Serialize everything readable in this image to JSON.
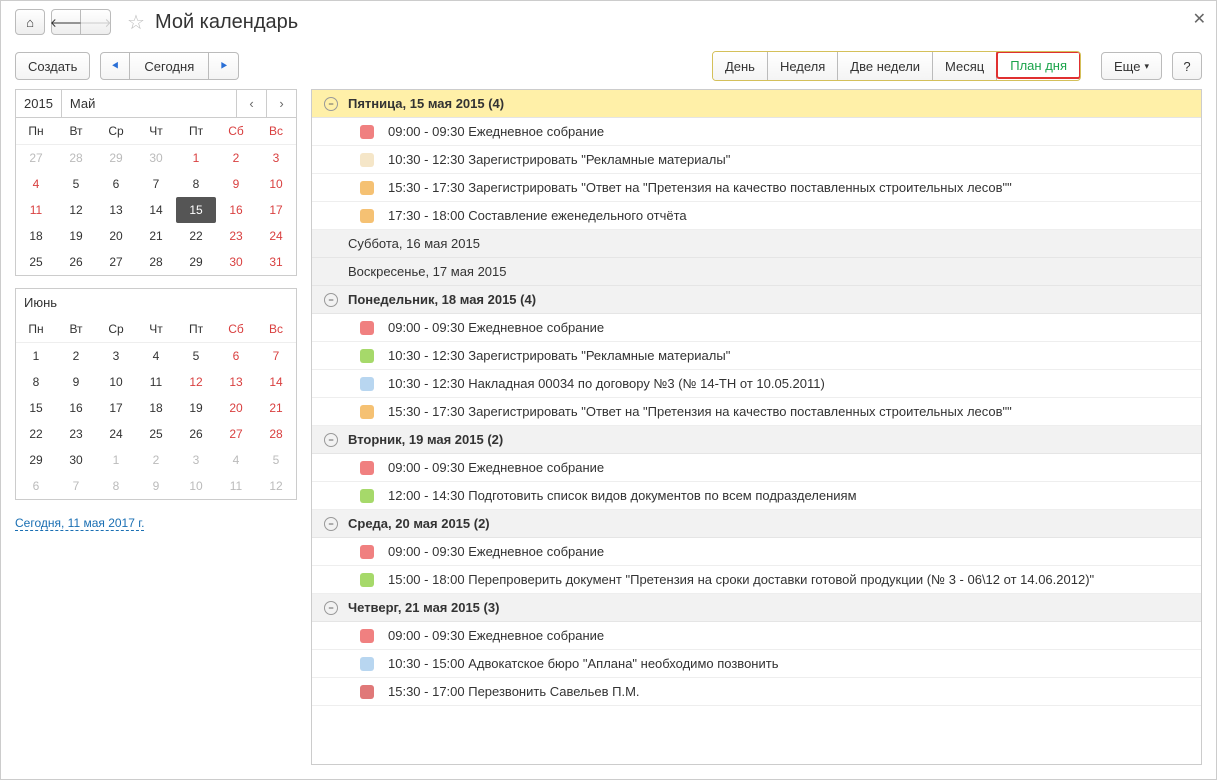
{
  "header": {
    "title": "Мой календарь"
  },
  "toolbar": {
    "create": "Создать",
    "today": "Сегодня",
    "more": "Еще",
    "help": "?"
  },
  "views": {
    "day": "День",
    "week": "Неделя",
    "two_weeks": "Две недели",
    "month": "Месяц",
    "day_plan": "План дня"
  },
  "minical1": {
    "year": "2015",
    "month": "Май",
    "weekdays": [
      "Пн",
      "Вт",
      "Ср",
      "Чт",
      "Пт",
      "Сб",
      "Вс"
    ],
    "rows": [
      [
        {
          "d": "27",
          "dim": true
        },
        {
          "d": "28",
          "dim": true
        },
        {
          "d": "29",
          "dim": true
        },
        {
          "d": "30",
          "dim": true
        },
        {
          "d": "1",
          "we": true
        },
        {
          "d": "2",
          "we": true
        },
        {
          "d": "3",
          "we": true
        }
      ],
      [
        {
          "d": "4",
          "we": true
        },
        {
          "d": "5"
        },
        {
          "d": "6"
        },
        {
          "d": "7"
        },
        {
          "d": "8"
        },
        {
          "d": "9",
          "we": true
        },
        {
          "d": "10",
          "we": true
        }
      ],
      [
        {
          "d": "11",
          "we": true
        },
        {
          "d": "12"
        },
        {
          "d": "13"
        },
        {
          "d": "14"
        },
        {
          "d": "15",
          "sel": true
        },
        {
          "d": "16",
          "we": true
        },
        {
          "d": "17",
          "we": true
        }
      ],
      [
        {
          "d": "18"
        },
        {
          "d": "19"
        },
        {
          "d": "20"
        },
        {
          "d": "21"
        },
        {
          "d": "22"
        },
        {
          "d": "23",
          "we": true
        },
        {
          "d": "24",
          "we": true
        }
      ],
      [
        {
          "d": "25"
        },
        {
          "d": "26"
        },
        {
          "d": "27"
        },
        {
          "d": "28"
        },
        {
          "d": "29"
        },
        {
          "d": "30",
          "we": true
        },
        {
          "d": "31",
          "we": true
        }
      ]
    ]
  },
  "minical2": {
    "month": "Июнь",
    "weekdays": [
      "Пн",
      "Вт",
      "Ср",
      "Чт",
      "Пт",
      "Сб",
      "Вс"
    ],
    "rows": [
      [
        {
          "d": "1"
        },
        {
          "d": "2"
        },
        {
          "d": "3"
        },
        {
          "d": "4"
        },
        {
          "d": "5"
        },
        {
          "d": "6",
          "we": true
        },
        {
          "d": "7",
          "we": true
        }
      ],
      [
        {
          "d": "8"
        },
        {
          "d": "9"
        },
        {
          "d": "10"
        },
        {
          "d": "11"
        },
        {
          "d": "12",
          "we": true
        },
        {
          "d": "13",
          "we": true
        },
        {
          "d": "14",
          "we": true
        }
      ],
      [
        {
          "d": "15"
        },
        {
          "d": "16"
        },
        {
          "d": "17"
        },
        {
          "d": "18"
        },
        {
          "d": "19"
        },
        {
          "d": "20",
          "we": true
        },
        {
          "d": "21",
          "we": true
        }
      ],
      [
        {
          "d": "22"
        },
        {
          "d": "23"
        },
        {
          "d": "24"
        },
        {
          "d": "25"
        },
        {
          "d": "26"
        },
        {
          "d": "27",
          "we": true
        },
        {
          "d": "28",
          "we": true
        }
      ],
      [
        {
          "d": "29"
        },
        {
          "d": "30"
        },
        {
          "d": "1",
          "dim": true
        },
        {
          "d": "2",
          "dim": true
        },
        {
          "d": "3",
          "dim": true
        },
        {
          "d": "4",
          "dim": true
        },
        {
          "d": "5",
          "dim": true
        }
      ],
      [
        {
          "d": "6",
          "dim": true
        },
        {
          "d": "7",
          "dim": true
        },
        {
          "d": "8",
          "dim": true
        },
        {
          "d": "9",
          "dim": true
        },
        {
          "d": "10",
          "dim": true
        },
        {
          "d": "11",
          "dim": true
        },
        {
          "d": "12",
          "dim": true
        }
      ]
    ]
  },
  "today_link": "Сегодня, 11 мая 2017 г.",
  "colors": {
    "red": "#f08080",
    "beige": "#f5e6c8",
    "orange": "#f5c173",
    "green": "#a6d96a",
    "blue": "#b8d6f0",
    "darkred": "#e07878"
  },
  "schedule": [
    {
      "type": "header",
      "style": "today",
      "label": "Пятница, 15 мая 2015 (4)",
      "toggle": true
    },
    {
      "type": "event",
      "color": "red",
      "text": "09:00 - 09:30 Ежедневное собрание"
    },
    {
      "type": "event",
      "color": "beige",
      "text": "10:30 - 12:30 Зарегистрировать \"Рекламные материалы\""
    },
    {
      "type": "event",
      "color": "orange",
      "text": "15:30 - 17:30 Зарегистрировать \"Ответ на \"Претензия на качество поставленных строительных лесов\"\""
    },
    {
      "type": "event",
      "color": "orange",
      "text": "17:30 - 18:00 Составление еженедельного отчёта"
    },
    {
      "type": "header",
      "style": "weekend",
      "label": "Суббота, 16 мая 2015"
    },
    {
      "type": "header",
      "style": "weekend",
      "label": "Воскресенье, 17 мая 2015"
    },
    {
      "type": "header",
      "style": "weekday",
      "label": "Понедельник, 18 мая 2015 (4)",
      "toggle": true
    },
    {
      "type": "event",
      "color": "red",
      "text": "09:00 - 09:30 Ежедневное собрание"
    },
    {
      "type": "event",
      "color": "green",
      "text": "10:30 - 12:30 Зарегистрировать \"Рекламные материалы\""
    },
    {
      "type": "event",
      "color": "blue",
      "text": "10:30 - 12:30 Накладная 00034 по договору №3 (№ 14-ТН от 10.05.2011)"
    },
    {
      "type": "event",
      "color": "orange",
      "text": "15:30 - 17:30 Зарегистрировать \"Ответ на \"Претензия на качество поставленных строительных лесов\"\""
    },
    {
      "type": "header",
      "style": "weekday",
      "label": "Вторник, 19 мая 2015 (2)",
      "toggle": true
    },
    {
      "type": "event",
      "color": "red",
      "text": "09:00 - 09:30 Ежедневное собрание"
    },
    {
      "type": "event",
      "color": "green",
      "text": "12:00 - 14:30 Подготовить список видов документов по всем подразделениям"
    },
    {
      "type": "header",
      "style": "weekday",
      "label": "Среда, 20 мая 2015 (2)",
      "toggle": true
    },
    {
      "type": "event",
      "color": "red",
      "text": "09:00 - 09:30 Ежедневное собрание"
    },
    {
      "type": "event",
      "color": "green",
      "text": "15:00 - 18:00 Перепроверить документ \"Претензия на сроки доставки готовой продукции (№ 3 - 06\\12 от 14.06.2012)\""
    },
    {
      "type": "header",
      "style": "weekday",
      "label": "Четверг, 21 мая 2015 (3)",
      "toggle": true
    },
    {
      "type": "event",
      "color": "red",
      "text": "09:00 - 09:30 Ежедневное собрание"
    },
    {
      "type": "event",
      "color": "blue",
      "text": "10:30 - 15:00 Адвокатское бюро \"Аплана\" необходимо позвонить"
    },
    {
      "type": "event",
      "color": "darkred",
      "text": "15:30 - 17:00 Перезвонить Савельев П.М."
    }
  ]
}
